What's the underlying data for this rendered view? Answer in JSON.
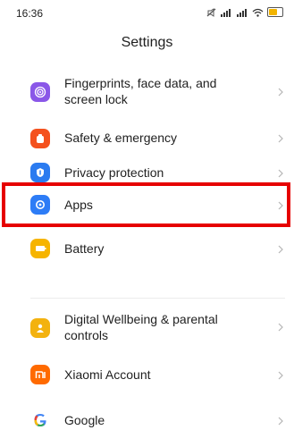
{
  "status_bar": {
    "time": "16:36"
  },
  "page": {
    "title": "Settings"
  },
  "items": [
    {
      "label": "Fingerprints, face data, and screen lock",
      "icon": "fingerprint-icon",
      "icon_color": "#8a57e8"
    },
    {
      "label": "Safety & emergency",
      "icon": "emergency-icon",
      "icon_color": "#f4511e"
    },
    {
      "label": "Privacy protection",
      "icon": "privacy-icon",
      "icon_color": "#2b7bf0"
    },
    {
      "label": "Apps",
      "icon": "apps-icon",
      "icon_color": "#2d7cf6"
    },
    {
      "label": "Battery",
      "icon": "battery-icon",
      "icon_color": "#f6b400"
    },
    {
      "label": "Digital Wellbeing & parental controls",
      "icon": "wellbeing-icon",
      "icon_color": "#f3b20f"
    },
    {
      "label": "Xiaomi Account",
      "icon": "xiaomi-icon",
      "icon_color": "#ff6a00"
    },
    {
      "label": "Google",
      "icon": "google-icon",
      "icon_color": "#4285f4"
    }
  ],
  "highlight_color": "#e60000"
}
